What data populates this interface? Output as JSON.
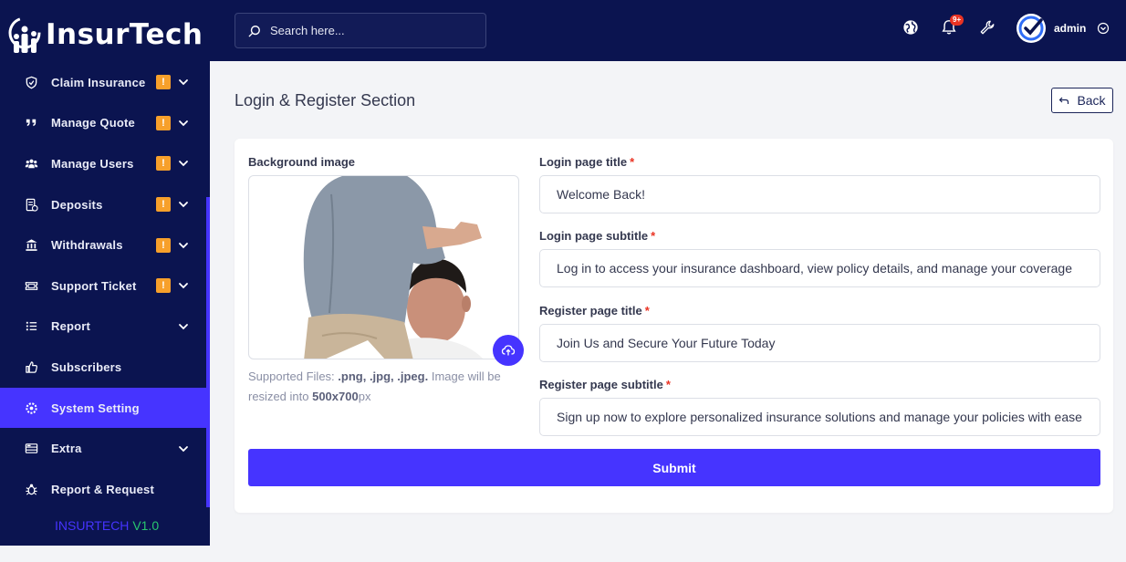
{
  "brand": {
    "name_part1": "Insur",
    "name_part2": "Tech",
    "version_part1": "INSURTECH",
    "version_part2": "V1.0"
  },
  "sidebar": {
    "items": [
      {
        "label": "Claim Insurance",
        "icon": "shield-icon",
        "warn": "!",
        "chevron": true,
        "active": false
      },
      {
        "label": "Manage Quote",
        "icon": "quote-icon",
        "warn": "!",
        "chevron": true,
        "active": false
      },
      {
        "label": "Manage Users",
        "icon": "users-icon",
        "warn": "!",
        "chevron": true,
        "active": false
      },
      {
        "label": "Deposits",
        "icon": "deposit-icon",
        "warn": "!",
        "chevron": true,
        "active": false
      },
      {
        "label": "Withdrawals",
        "icon": "bank-icon",
        "warn": "!",
        "chevron": true,
        "active": false
      },
      {
        "label": "Support Ticket",
        "icon": "ticket-icon",
        "warn": "!",
        "chevron": true,
        "active": false
      },
      {
        "label": "Report",
        "icon": "list-icon",
        "warn": "",
        "chevron": true,
        "active": false
      },
      {
        "label": "Subscribers",
        "icon": "thumbs-up-icon",
        "warn": "",
        "chevron": false,
        "active": false
      },
      {
        "label": "System Setting",
        "icon": "gear-icon",
        "warn": "",
        "chevron": false,
        "active": true
      },
      {
        "label": "Extra",
        "icon": "server-icon",
        "warn": "",
        "chevron": true,
        "active": false
      },
      {
        "label": "Report & Request",
        "icon": "bug-icon",
        "warn": "",
        "chevron": false,
        "active": false
      }
    ]
  },
  "topbar": {
    "search_placeholder": "Search here...",
    "notification_count": "9+",
    "username": "admin"
  },
  "main": {
    "title": "Login & Register Section",
    "back_label": "Back",
    "background_label": "Background image",
    "hint_prefix": "Supported Files: ",
    "hint_types": ".png, .jpg, .jpeg.",
    "hint_middle": " Image will be resized into ",
    "hint_size": "500x700",
    "hint_suffix": "px",
    "fields": {
      "login_title": {
        "label": "Login page title",
        "value": "Welcome Back!"
      },
      "login_subtitle": {
        "label": "Login page subtitle",
        "value": "Log in to access your insurance dashboard, view policy details, and manage your coverage"
      },
      "register_title": {
        "label": "Register page title",
        "value": "Join Us and Secure Your Future Today"
      },
      "register_subtitle": {
        "label": "Register page subtitle",
        "value": "Sign up now to explore personalized insurance solutions and manage your policies with ease"
      }
    },
    "required_mark": "*",
    "submit_label": "Submit"
  },
  "colors": {
    "sidebar_bg": "#0b1450",
    "accent": "#4634ff",
    "warning": "#f7a02b",
    "danger": "#ea3323",
    "success": "#28c76f"
  }
}
